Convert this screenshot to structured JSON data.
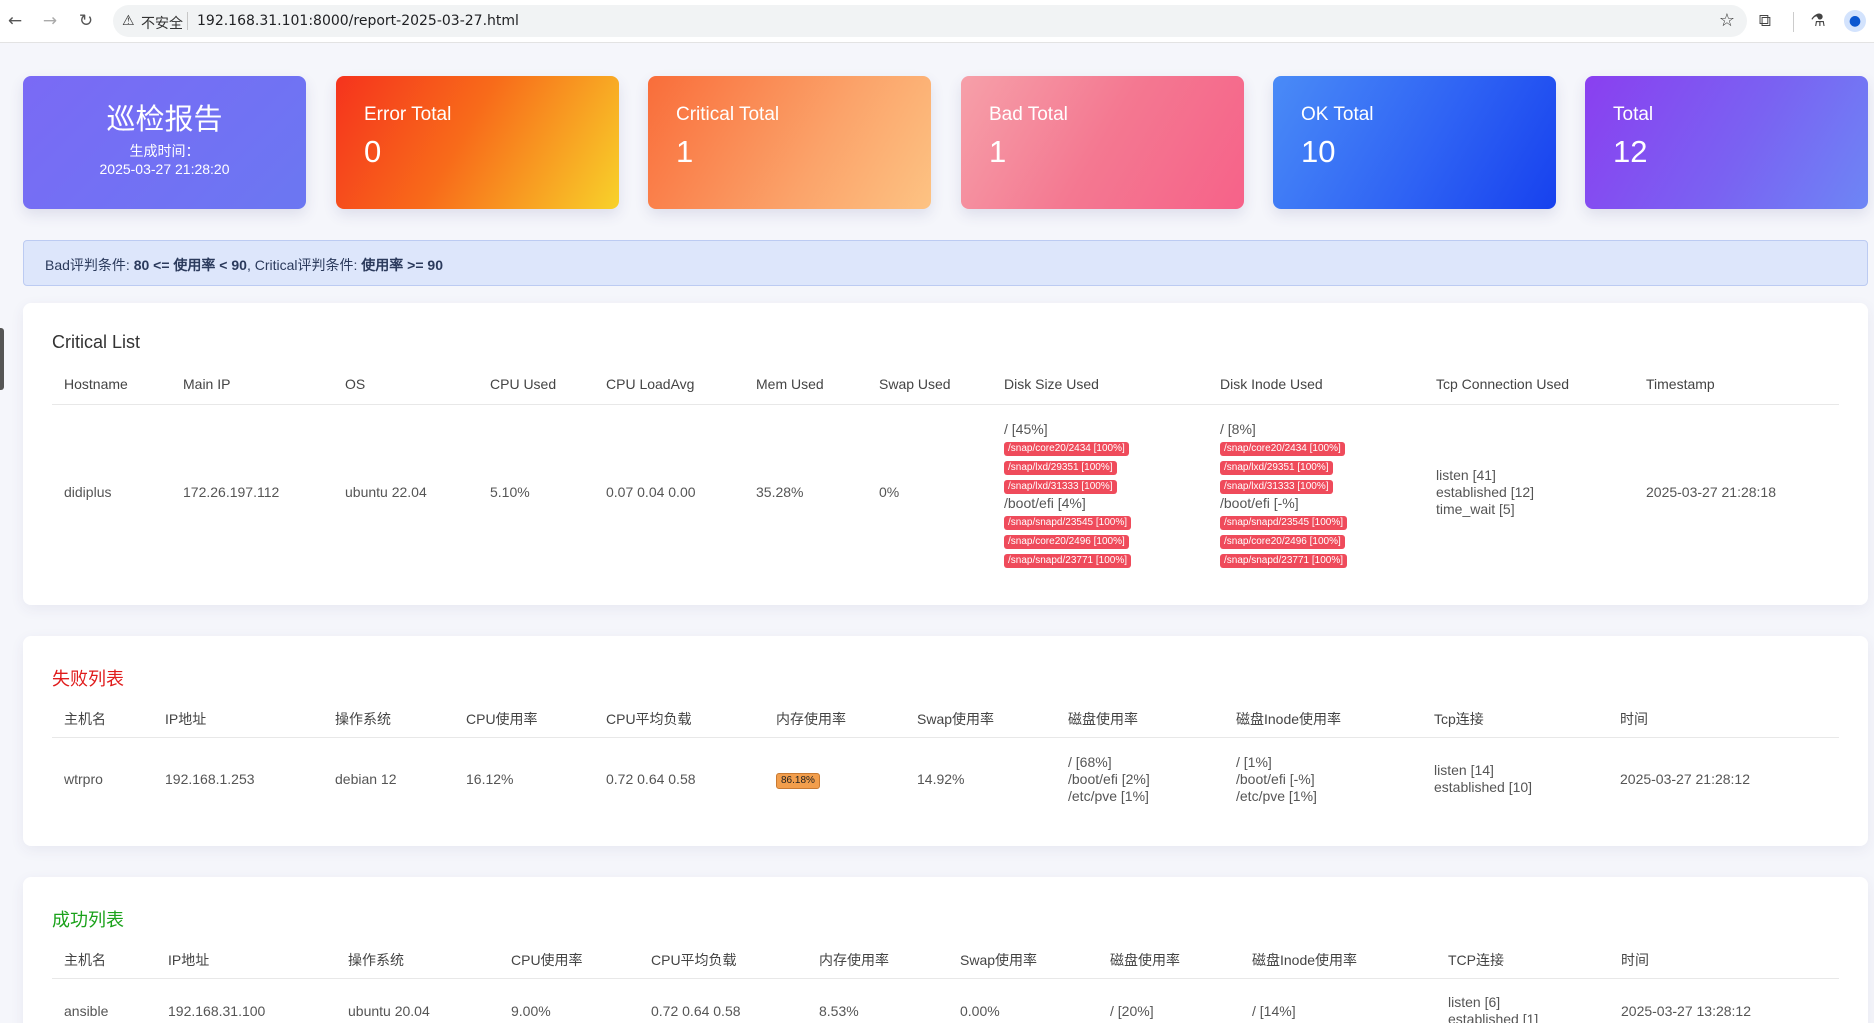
{
  "browser": {
    "insecure_label": "不安全",
    "url": "192.168.31.101:8000/report-2025-03-27.html"
  },
  "cards": {
    "title": "巡检报告",
    "generated_label": "生成时间：",
    "generated_time": "2025-03-27 21:28:20",
    "error": {
      "label": "Error Total",
      "value": "0"
    },
    "critical": {
      "label": "Critical Total",
      "value": "1"
    },
    "bad": {
      "label": "Bad Total",
      "value": "1"
    },
    "ok": {
      "label": "OK Total",
      "value": "10"
    },
    "total": {
      "label": "Total",
      "value": "12"
    }
  },
  "alert": {
    "p1": "Bad评判条件: ",
    "b1": "80 <= 使用率 < 90",
    "p2": ", Critical评判条件: ",
    "b2": "使用率 >= 90"
  },
  "critical_list": {
    "title": "Critical List",
    "headers": [
      "Hostname",
      "Main IP",
      "OS",
      "CPU Used",
      "CPU LoadAvg",
      "Mem Used",
      "Swap Used",
      "Disk Size Used",
      "Disk Inode Used",
      "Tcp Connection Used",
      "Timestamp"
    ],
    "row": {
      "hostname": "didiplus",
      "ip": "172.26.197.112",
      "os": "ubuntu 22.04",
      "cpu": "5.10%",
      "load": "0.07 0.04 0.00",
      "mem": "35.28%",
      "swap": "0%",
      "disk": [
        "/ [45%]",
        "/snap/core20/2434 [100%]",
        "/snap/lxd/29351 [100%]",
        "/snap/lxd/31333 [100%]",
        "/boot/efi [4%]",
        "/snap/snapd/23545 [100%]",
        "/snap/core20/2496 [100%]",
        "/snap/snapd/23771 [100%]"
      ],
      "inode": [
        "/ [8%]",
        "/snap/core20/2434 [100%]",
        "/snap/lxd/29351 [100%]",
        "/snap/lxd/31333 [100%]",
        "/boot/efi [-%]",
        "/snap/snapd/23545 [100%]",
        "/snap/core20/2496 [100%]",
        "/snap/snapd/23771 [100%]"
      ],
      "tcp": [
        "listen [41]",
        "established [12]",
        "time_wait [5]"
      ],
      "timestamp": "2025-03-27 21:28:18"
    }
  },
  "failed_list": {
    "title": "失败列表",
    "title_color": "#e01c1c",
    "headers": [
      "主机名",
      "IP地址",
      "操作系统",
      "CPU使用率",
      "CPU平均负载",
      "内存使用率",
      "Swap使用率",
      "磁盘使用率",
      "磁盘Inode使用率",
      "Tcp连接",
      "时间"
    ],
    "row": {
      "hostname": "wtrpro",
      "ip": "192.168.1.253",
      "os": "debian 12",
      "cpu": "16.12%",
      "load": "0.72 0.64 0.58",
      "mem": "86.18%",
      "swap": "14.92%",
      "disk": [
        "/ [68%]",
        "/boot/efi [2%]",
        "/etc/pve [1%]"
      ],
      "inode": [
        "/ [1%]",
        "/boot/efi [-%]",
        "/etc/pve [1%]"
      ],
      "tcp": [
        "listen [14]",
        "established [10]"
      ],
      "timestamp": "2025-03-27 21:28:12"
    }
  },
  "success_list": {
    "title": "成功列表",
    "title_color": "#1aa21a",
    "headers": [
      "主机名",
      "IP地址",
      "操作系统",
      "CPU使用率",
      "CPU平均负载",
      "内存使用率",
      "Swap使用率",
      "磁盘使用率",
      "磁盘Inode使用率",
      "TCP连接",
      "时间"
    ],
    "row": {
      "hostname": "ansible",
      "ip": "192.168.31.100",
      "os": "ubuntu 20.04",
      "cpu": "9.00%",
      "load": "0.72 0.64 0.58",
      "mem": "8.53%",
      "swap": "0.00%",
      "disk": [
        "/ [20%]"
      ],
      "inode": [
        "/ [14%]"
      ],
      "tcp": [
        "listen [6]",
        "established [1]"
      ],
      "timestamp": "2025-03-27 13:28:12"
    }
  }
}
